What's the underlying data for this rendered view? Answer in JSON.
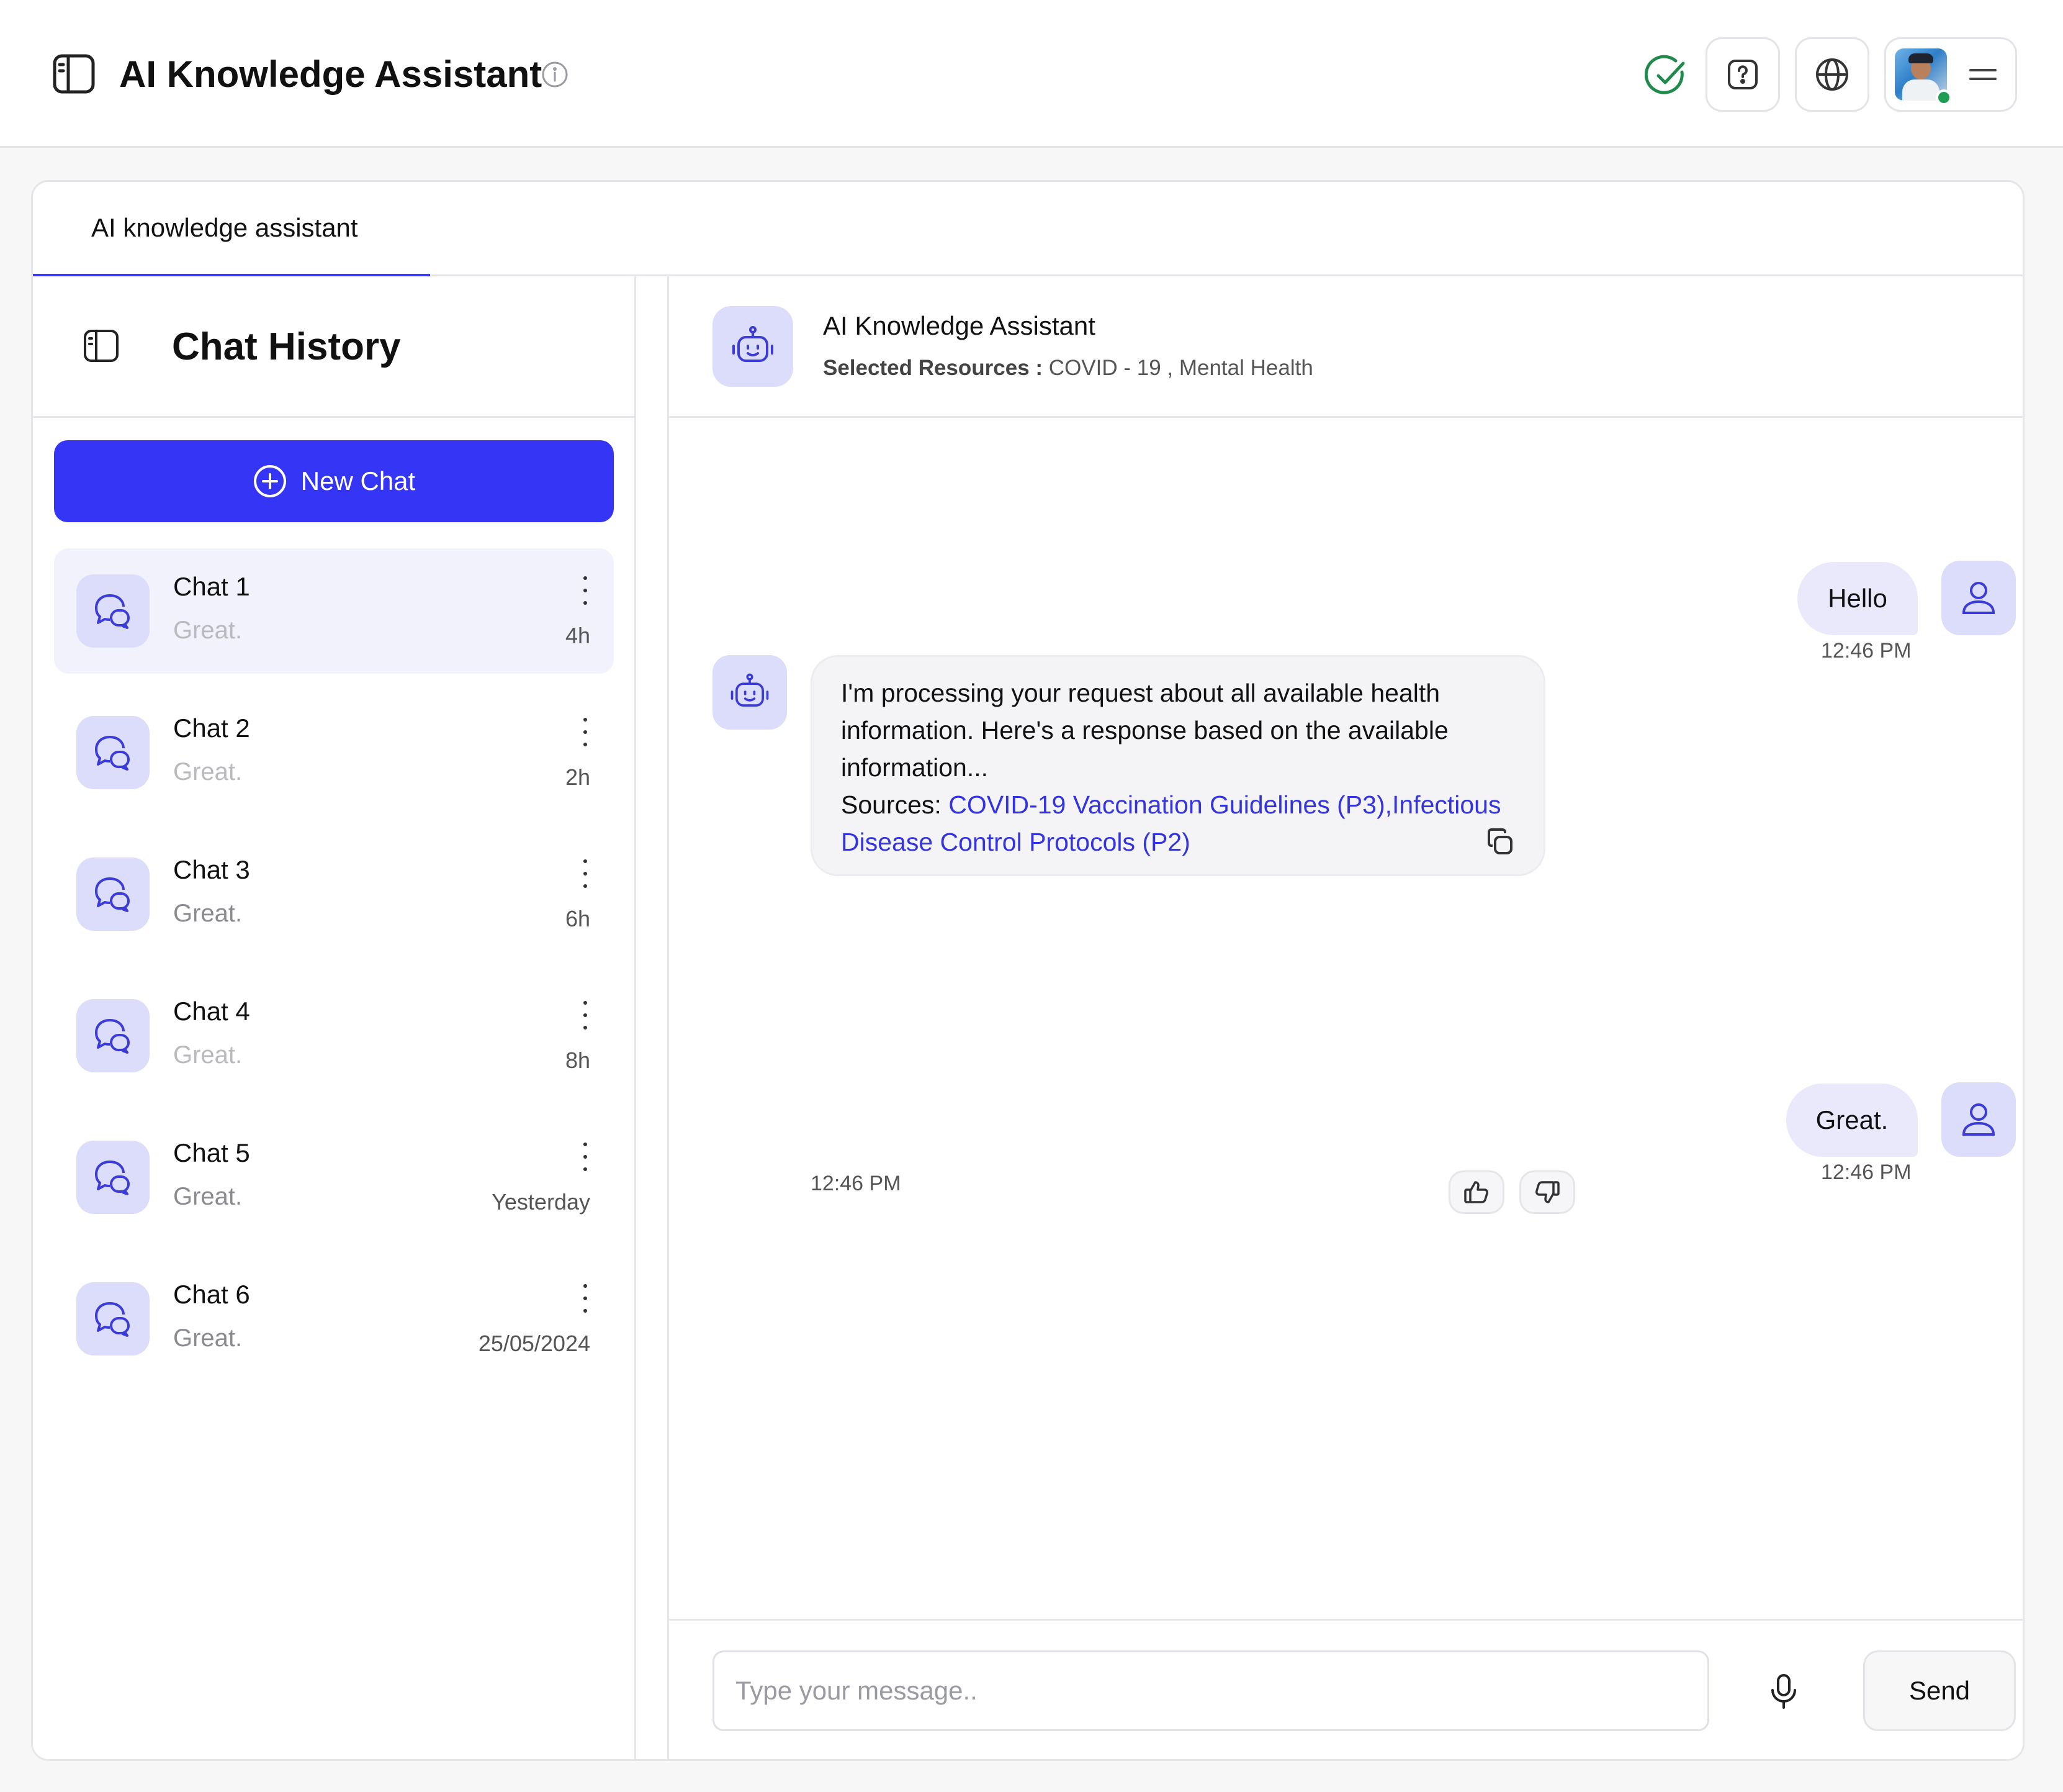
{
  "header": {
    "app_title": "AI Knowledge Assistant",
    "icons": [
      "sidebar-toggle-icon",
      "info-icon",
      "check-circle-icon",
      "help-icon",
      "globe-icon",
      "avatar",
      "menu-icon"
    ],
    "status_color": "#1f8a4c"
  },
  "tabs": [
    {
      "label": "AI knowledge assistant",
      "active": true
    }
  ],
  "sidebar": {
    "title": "Chat History",
    "new_chat_label": "New Chat",
    "accent": "#3535f6",
    "chats": [
      {
        "name": "Chat 1",
        "preview": "Great.",
        "time": "4h",
        "active": true
      },
      {
        "name": "Chat 2",
        "preview": "Great.",
        "time": "2h"
      },
      {
        "name": "Chat 3",
        "preview": "Great.",
        "time": "6h"
      },
      {
        "name": "Chat 4",
        "preview": "Great.",
        "time": "8h"
      },
      {
        "name": "Chat 5",
        "preview": "Great.",
        "time": "Yesterday"
      },
      {
        "name": "Chat 6",
        "preview": "Great.",
        "time": "25/05/2024"
      }
    ]
  },
  "chat": {
    "title": "AI Knowledge Assistant",
    "resources_label": "Selected Resources :",
    "resources_value": "COVID - 19 , Mental Health",
    "messages": [
      {
        "role": "user",
        "text": "Hello",
        "time": "12:46 PM"
      },
      {
        "role": "assistant",
        "text": "I'm processing your request about all available health information. Here's a response based on the available information...",
        "sources_label": "Sources:",
        "sources": "COVID-19 Vaccination Guidelines (P3),Infectious Disease Control Protocols (P2)",
        "time": "12:46 PM"
      },
      {
        "role": "user",
        "text": "Great.",
        "time": "12:46 PM"
      }
    ],
    "input_placeholder": "Type your message..",
    "send_label": "Send"
  }
}
